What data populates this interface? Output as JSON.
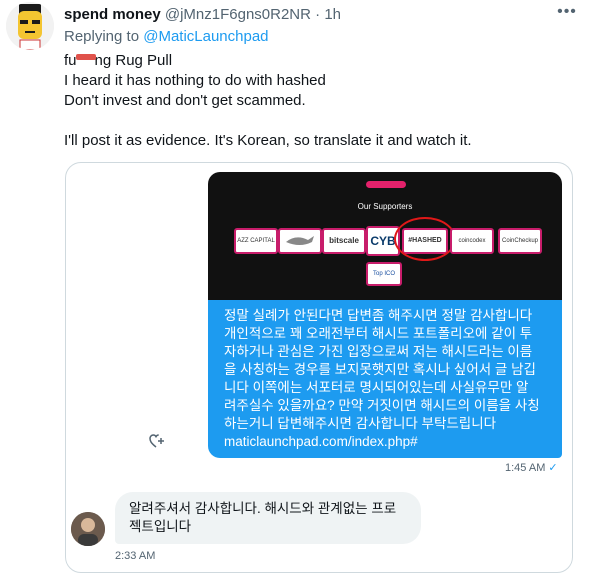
{
  "tweet": {
    "author_name": "spend money",
    "author_handle": "@jMnz1F6gns0R2NR",
    "separator": "·",
    "time": "1h",
    "replying_prefix": "Replying to ",
    "replying_to": "@MaticLaunchpad",
    "text_line1_prefix": "fu",
    "text_line1_suffix": "ng Rug Pull",
    "text_line2": "I heard it has nothing to do with hashed",
    "text_line3": "Don't invest and don't get scammed.",
    "text_line5": "I'll post it as evidence. It's Korean, so translate it and watch it.",
    "more_icon": "more-icon"
  },
  "media": {
    "screenshot": {
      "heading": "Our Supporters",
      "logos": [
        "AZZ CAPITAL",
        "",
        "bitscale",
        "CYB",
        "#HASHED",
        "coincodex",
        "CoinCheckup",
        "Top ICO List"
      ],
      "accent_color": "#e4216b",
      "highlight_color": "#e01818"
    },
    "sent_message": {
      "lines": [
        "정말 실례가 안된다면 답변좀 해주시면 정말 감사합니다",
        "개인적으로 꽤 오래전부터 해시드 포트폴리오에 같이 투",
        "자하거나 관심은 가진 입장으로써 저는 해시드라는 이름",
        "을 사칭하는 경우를 보지못햇지만 혹시나 싶어서 글 남깁",
        "니다 이쪽에는 서포터로 명시되어있는데 사실유무만 알",
        "려주실수 있을까요? 만약 거짓이면 해시드의 이름을 사칭",
        "하는거니 답변해주시면 감사합니다 부탁드립니다"
      ],
      "link": "maticlaunchpad.com/index.php#",
      "time": "1:45 AM",
      "status_icon": "check-icon",
      "bubble_color": "#1d9bf0"
    },
    "received_message": {
      "lines": [
        "알려주셔서 감사합니다. 해시드와 관계없는 프로",
        "젝트입니다"
      ],
      "time": "2:33 AM"
    }
  }
}
